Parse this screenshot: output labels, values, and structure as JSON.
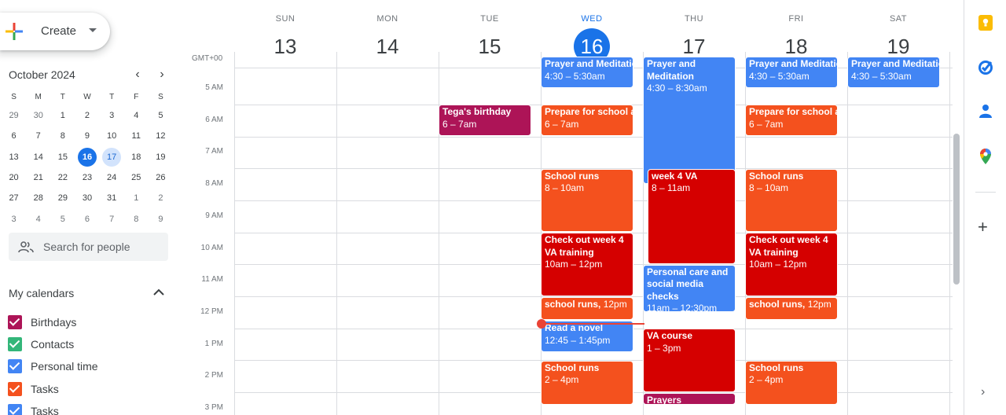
{
  "create": {
    "label": "Create"
  },
  "mini_calendar": {
    "title": "October 2024",
    "prev_icon": "chevron-left-icon",
    "next_icon": "chevron-right-icon",
    "weekdays": [
      "S",
      "M",
      "T",
      "W",
      "T",
      "F",
      "S"
    ],
    "weeks": [
      [
        "29",
        "30",
        "1",
        "2",
        "3",
        "4",
        "5"
      ],
      [
        "6",
        "7",
        "8",
        "9",
        "10",
        "11",
        "12"
      ],
      [
        "13",
        "14",
        "15",
        "16",
        "17",
        "18",
        "19"
      ],
      [
        "20",
        "21",
        "22",
        "23",
        "24",
        "25",
        "26"
      ],
      [
        "27",
        "28",
        "29",
        "30",
        "31",
        "1",
        "2"
      ],
      [
        "3",
        "4",
        "5",
        "6",
        "7",
        "8",
        "9"
      ]
    ],
    "today": "16",
    "selected": "17"
  },
  "search_people": {
    "placeholder": "Search for people"
  },
  "my_calendars": {
    "title": "My calendars",
    "items": [
      {
        "label": "Birthdays",
        "color": "#ad1457"
      },
      {
        "label": "Contacts",
        "color": "#33b679"
      },
      {
        "label": "Personal time",
        "color": "#4285f4"
      },
      {
        "label": "Tasks",
        "color": "#f4511e"
      },
      {
        "label": "Tasks",
        "color": "#4285f4"
      }
    ]
  },
  "week": {
    "timezone": "GMT+00",
    "days": [
      {
        "dow": "SUN",
        "num": "13"
      },
      {
        "dow": "MON",
        "num": "14"
      },
      {
        "dow": "TUE",
        "num": "15"
      },
      {
        "dow": "WED",
        "num": "16",
        "today": true
      },
      {
        "dow": "THU",
        "num": "17"
      },
      {
        "dow": "FRI",
        "num": "18"
      },
      {
        "dow": "SAT",
        "num": "19"
      }
    ],
    "hours": [
      "5 AM",
      "6 AM",
      "7 AM",
      "8 AM",
      "9 AM",
      "10 AM",
      "11 AM",
      "12 PM",
      "1 PM",
      "2 PM",
      "3 PM"
    ]
  },
  "events": {
    "tue_birthday": {
      "title": "Tega's birthday",
      "time": "6 – 7am",
      "color": "#ad1457"
    },
    "wed_prayer": {
      "title": "Prayer and Meditation",
      "time": "4:30 – 5:30am",
      "color": "#4285f4"
    },
    "wed_prepare": {
      "title": "Prepare for school a",
      "time": "6 – 7am",
      "color": "#f4511e"
    },
    "wed_school": {
      "title": "School runs",
      "time": "8 – 10am",
      "color": "#f4511e"
    },
    "wed_check": {
      "title": "Check out week 4 VA training",
      "time": "10am – 12pm",
      "color": "#d50000"
    },
    "wed_schoolruns12": {
      "title": "school runs",
      "time": "12pm",
      "color": "#f4511e"
    },
    "wed_novel": {
      "title": "Read a novel",
      "time": "12:45 – 1:45pm",
      "color": "#4285f4"
    },
    "wed_school2": {
      "title": "School runs",
      "time": "2 – 4pm",
      "color": "#f4511e"
    },
    "thu_prayer": {
      "title": "Prayer and Meditation",
      "time": "4:30 – 8:30am",
      "color": "#4285f4"
    },
    "thu_week4": {
      "title": "week 4 VA",
      "time": "8 – 11am",
      "color": "#d50000"
    },
    "thu_personal": {
      "title": "Personal care and social media checks",
      "time": "11am – 12:30pm",
      "color": "#4285f4"
    },
    "thu_vacourse": {
      "title": "VA course",
      "time": "1 – 3pm",
      "color": "#d50000"
    },
    "thu_prayers": {
      "title": "Prayers",
      "color": "#ad1457"
    },
    "fri_prayer": {
      "title": "Prayer and Meditatio",
      "time": "4:30 – 5:30am",
      "color": "#4285f4"
    },
    "fri_prepare": {
      "title": "Prepare for school a",
      "time": "6 – 7am",
      "color": "#f4511e"
    },
    "fri_school": {
      "title": "School runs",
      "time": "8 – 10am",
      "color": "#f4511e"
    },
    "fri_check": {
      "title": "Check out week 4 VA training",
      "time": "10am – 12pm",
      "color": "#d50000"
    },
    "fri_schoolruns12": {
      "title": "school runs",
      "time": "12pm",
      "color": "#f4511e"
    },
    "fri_school2": {
      "title": "School runs",
      "time": "2 – 4pm",
      "color": "#f4511e"
    },
    "sat_prayer": {
      "title": "Prayer and Meditatio",
      "time": "4:30 – 5:30am",
      "color": "#4285f4"
    }
  },
  "side_panel": {
    "icons": [
      "keep-icon",
      "tasks-icon",
      "contacts-icon",
      "maps-icon"
    ],
    "add_label": "+",
    "expand_label": "›"
  }
}
